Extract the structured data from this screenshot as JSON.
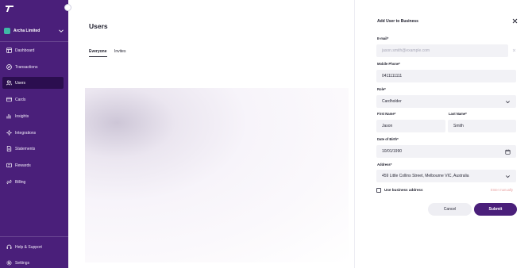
{
  "sidebar": {
    "org_name": "Archa Limited",
    "items": [
      {
        "label": "Dashboard",
        "icon": "dashboard-icon"
      },
      {
        "label": "Transactions",
        "icon": "transactions-icon"
      },
      {
        "label": "Users",
        "icon": "users-icon",
        "active": true
      },
      {
        "label": "Cards",
        "icon": "card-icon"
      },
      {
        "label": "Insights",
        "icon": "insights-icon"
      },
      {
        "label": "Integrations",
        "icon": "integrations-icon"
      },
      {
        "label": "Statements",
        "icon": "statements-icon"
      },
      {
        "label": "Rewards",
        "icon": "rewards-icon"
      },
      {
        "label": "Billing",
        "icon": "billing-icon"
      }
    ],
    "bottom_items": [
      {
        "label": "Help & Support",
        "icon": "headset-icon"
      },
      {
        "label": "Settings",
        "icon": "gear-icon"
      }
    ]
  },
  "main": {
    "title": "Users",
    "tabs": [
      {
        "label": "Everyone",
        "active": true
      },
      {
        "label": "Invites",
        "active": false
      }
    ]
  },
  "panel": {
    "title": "Add User to Business",
    "email": {
      "label": "E-mail*",
      "placeholder": "jason.smith@example.com"
    },
    "mobile": {
      "label": "Mobile Phone*",
      "value": "0411111111"
    },
    "role": {
      "label": "Role*",
      "value": "Cardholder"
    },
    "first_name": {
      "label": "First Name*",
      "value": "Jason"
    },
    "last_name": {
      "label": "Last Name*",
      "value": "Smith"
    },
    "dob": {
      "label": "Date of Birth*",
      "value": "10/01/1990"
    },
    "address": {
      "label": "Address*",
      "value": "459 Little Collins Street, Melbourne VIC, Australia"
    },
    "use_business_address": "Use business address",
    "enter_manually": "Enter manually",
    "cancel_label": "Cancel",
    "submit_label": "Submit"
  },
  "colors": {
    "sidebar_bg": "#4a1f7a",
    "sidebar_active": "#2b0e4f",
    "accent": "#4a1f7a",
    "org_avatar": "#3fb8a6"
  }
}
